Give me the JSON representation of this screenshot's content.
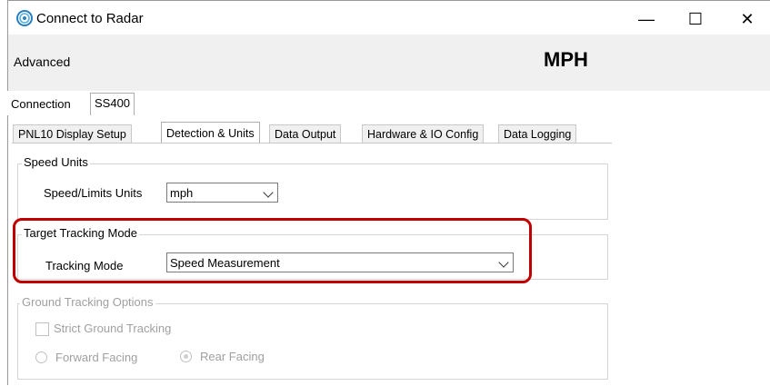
{
  "window": {
    "title": "Connect to Radar",
    "controls": {
      "minimize": "—",
      "maximize": "☐",
      "close": "✕"
    }
  },
  "menu": {
    "advanced": "Advanced"
  },
  "header": {
    "units_display": "MPH"
  },
  "outer_tabs": [
    "Connection",
    "SS400"
  ],
  "inner_tabs": [
    "PNL10 Display Setup",
    "Detection & Units",
    "Data Output",
    "Hardware & IO Config",
    "Data Logging"
  ],
  "speed_units": {
    "group_title": "Speed Units",
    "label": "Speed/Limits Units",
    "value": "mph"
  },
  "target_tracking": {
    "group_title": "Target Tracking Mode",
    "label": "Tracking Mode",
    "value": "Speed Measurement"
  },
  "ground_tracking": {
    "group_title": "Ground Tracking Options",
    "strict_label": "Strict Ground Tracking",
    "forward_label": "Forward Facing",
    "rear_label": "Rear Facing"
  }
}
